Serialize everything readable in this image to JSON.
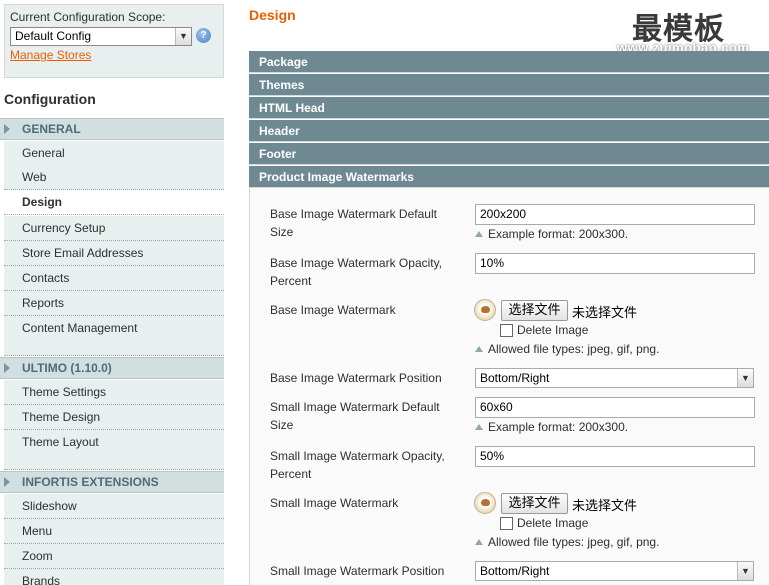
{
  "scope": {
    "label": "Current Configuration Scope:",
    "selected": "Default Config",
    "manage_stores": "Manage Stores"
  },
  "sidebar": {
    "title": "Configuration",
    "sections": [
      {
        "heading": "GENERAL",
        "items": [
          "General",
          "Web",
          "Design",
          "Currency Setup",
          "Store Email Addresses",
          "Contacts",
          "Reports",
          "Content Management"
        ]
      },
      {
        "heading": "ULTIMO (1.10.0)",
        "items": [
          "Theme Settings",
          "Theme Design",
          "Theme Layout"
        ]
      },
      {
        "heading": "INFORTIS EXTENSIONS",
        "items": [
          "Slideshow",
          "Menu",
          "Zoom",
          "Brands"
        ]
      }
    ],
    "active_item": "Design"
  },
  "page": {
    "title": "Design",
    "watermark_logo": "最模板",
    "watermark_url": "www.zuimoban.com"
  },
  "fieldsets": [
    "Package",
    "Themes",
    "HTML Head",
    "Header",
    "Footer",
    "Product Image Watermarks"
  ],
  "form": {
    "base_size_label": "Base Image Watermark Default Size",
    "base_size_value": "200x200",
    "base_size_hint": "Example format: 200x300.",
    "base_opacity_label": "Base Image Watermark Opacity, Percent",
    "base_opacity_value": "10%",
    "base_watermark_label": "Base Image Watermark",
    "base_file_button": "选择文件",
    "base_file_status": "未选择文件",
    "base_delete_label": "Delete Image",
    "base_allowed_hint": "Allowed file types: jpeg, gif, png.",
    "base_position_label": "Base Image Watermark Position",
    "base_position_value": "Bottom/Right",
    "small_size_label": "Small Image Watermark Default Size",
    "small_size_value": "60x60",
    "small_size_hint": "Example format: 200x300.",
    "small_opacity_label": "Small Image Watermark Opacity, Percent",
    "small_opacity_value": "50%",
    "small_watermark_label": "Small Image Watermark",
    "small_file_button": "选择文件",
    "small_file_status": "未选择文件",
    "small_delete_label": "Delete Image",
    "small_allowed_hint": "Allowed file types: jpeg, gif, png.",
    "small_position_label": "Small Image Watermark Position",
    "small_position_value": "Bottom/Right"
  },
  "icons": {
    "help": "help-icon",
    "dropdown": "chevron-down-icon",
    "section": "triangle-right-icon",
    "hint": "triangle-up-icon",
    "image_preview": "image-preview-icon"
  }
}
